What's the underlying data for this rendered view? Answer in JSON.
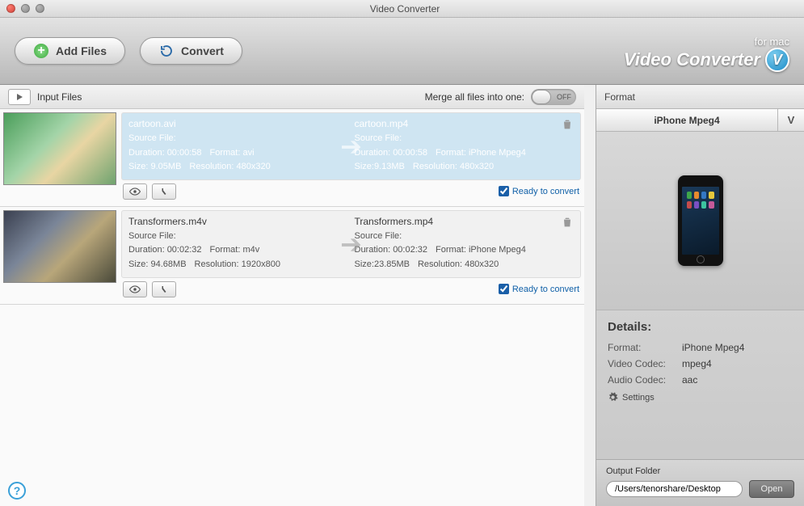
{
  "window_title": "Video Converter",
  "toolbar": {
    "add_label": "Add Files",
    "convert_label": "Convert"
  },
  "brand": {
    "sub": "for mac",
    "main": "Video Converter",
    "badge": "V"
  },
  "list_header": {
    "label": "Input Files",
    "merge_label": "Merge all files into one:",
    "toggle_state": "OFF"
  },
  "files": [
    {
      "selected": true,
      "thumb_class": "cartoon",
      "src": {
        "name": "cartoon.avi",
        "sf_label": "Source File:",
        "duration": "Duration: 00:00:58",
        "format": "Format: avi",
        "size": "Size: 9.05MB",
        "resolution": "Resolution: 480x320"
      },
      "dst": {
        "name": "cartoon.mp4",
        "sf_label": "Source File:",
        "duration": "Duration: 00:00:58",
        "format": "Format: iPhone Mpeg4",
        "size": "Size:9.13MB",
        "resolution": "Resolution: 480x320"
      },
      "ready_label": "Ready to convert"
    },
    {
      "selected": false,
      "thumb_class": "film",
      "src": {
        "name": "Transformers.m4v",
        "sf_label": "Source File:",
        "duration": "Duration: 00:02:32",
        "format": "Format: m4v",
        "size": "Size: 94.68MB",
        "resolution": "Resolution: 1920x800"
      },
      "dst": {
        "name": "Transformers.mp4",
        "sf_label": "Source File:",
        "duration": "Duration: 00:02:32",
        "format": "Format: iPhone Mpeg4",
        "size": "Size:23.85MB",
        "resolution": "Resolution: 480x320"
      },
      "ready_label": "Ready to convert"
    }
  ],
  "right": {
    "header": "Format",
    "selected_format": "iPhone Mpeg4",
    "v_label": "V",
    "details_title": "Details:",
    "details": {
      "format_k": "Format:",
      "format_v": "iPhone Mpeg4",
      "vcodec_k": "Video Codec:",
      "vcodec_v": "mpeg4",
      "acodec_k": "Audio Codec:",
      "acodec_v": "aac"
    },
    "settings_label": "Settings",
    "output_label": "Output Folder",
    "output_path": "/Users/tenorshare/Desktop",
    "open_label": "Open"
  },
  "help_label": "?"
}
